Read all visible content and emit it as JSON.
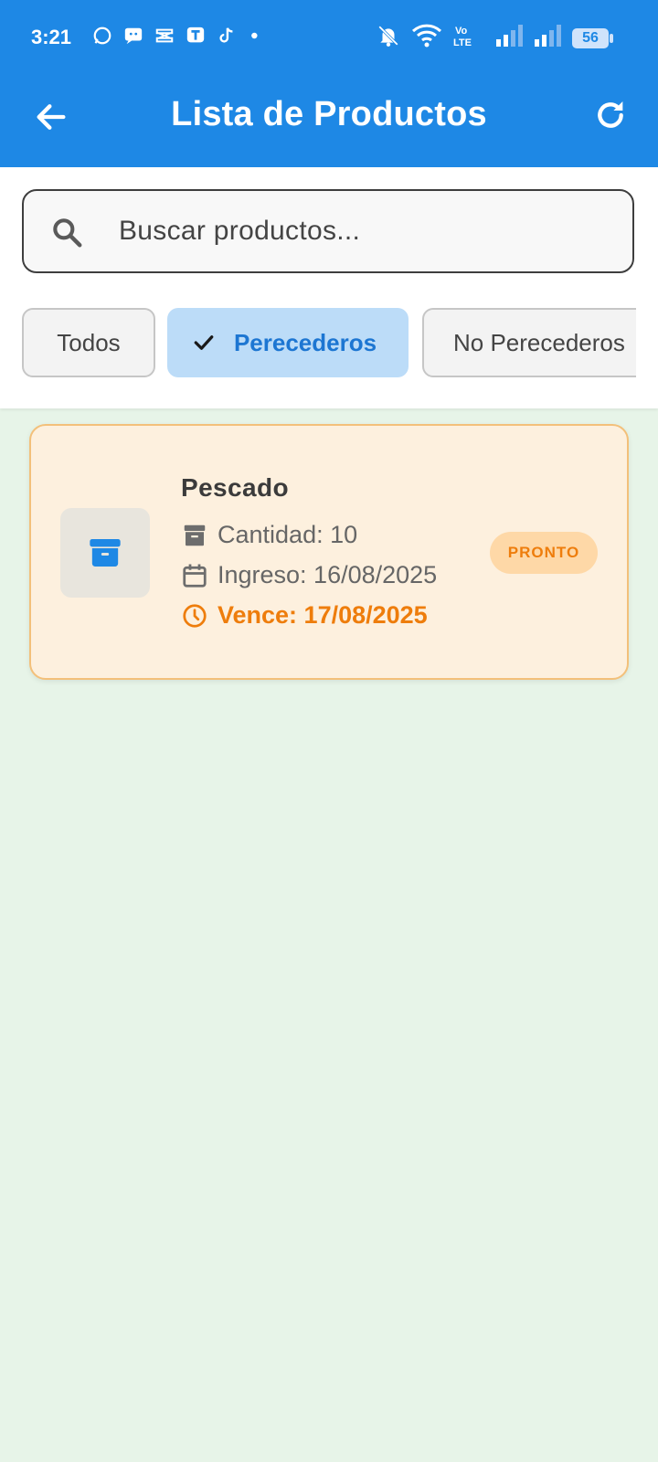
{
  "status_bar": {
    "time": "3:21",
    "battery": "56"
  },
  "app_bar": {
    "title": "Lista de Productos"
  },
  "search": {
    "placeholder": "Buscar productos..."
  },
  "filters": [
    {
      "label": "Todos",
      "selected": false
    },
    {
      "label": "Perecederos",
      "selected": true
    },
    {
      "label": "No Perecederos",
      "selected": false
    }
  ],
  "products": [
    {
      "name": "Pescado",
      "quantity": "Cantidad: 10",
      "entry": "Ingreso: 16/08/2025",
      "expires": "Vence: 17/08/2025",
      "badge": "PRONTO"
    }
  ],
  "colors": {
    "primary": "#1e88e5",
    "warning": "#ee7d0c",
    "background": "#e7f4e8"
  }
}
